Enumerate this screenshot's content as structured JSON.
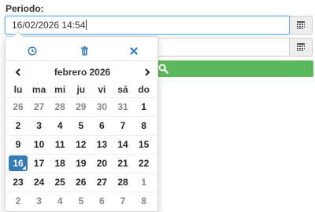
{
  "form": {
    "label": "Periodo:",
    "start_value": "16/02/2026 14:54",
    "end_value": ""
  },
  "colors": {
    "accent": "#337ab7",
    "search_button": "#5cb85c",
    "icon_blue": "#337ab7"
  },
  "icons": {
    "calendar_addon": "calendar-icon",
    "clock": "clock-icon",
    "trash": "trash-icon",
    "close": "close-icon",
    "prev": "chevron-left-icon",
    "next": "chevron-right-icon",
    "search": "search-icon"
  },
  "calendar": {
    "month_label": "febrero 2026",
    "weekdays": [
      "lu",
      "ma",
      "mi",
      "ju",
      "vi",
      "sá",
      "do"
    ],
    "weeks": [
      [
        "26",
        "27",
        "28",
        "29",
        "30",
        "31",
        "1"
      ],
      [
        "2",
        "3",
        "4",
        "5",
        "6",
        "7",
        "8"
      ],
      [
        "9",
        "10",
        "11",
        "12",
        "13",
        "14",
        "15"
      ],
      [
        "16",
        "17",
        "18",
        "19",
        "20",
        "21",
        "22"
      ],
      [
        "23",
        "24",
        "25",
        "26",
        "27",
        "28",
        "1"
      ],
      [
        "2",
        "3",
        "4",
        "5",
        "6",
        "7",
        "8"
      ]
    ],
    "other_month_flags": [
      [
        true,
        true,
        true,
        true,
        true,
        true,
        false
      ],
      [
        false,
        false,
        false,
        false,
        false,
        false,
        false
      ],
      [
        false,
        false,
        false,
        false,
        false,
        false,
        false
      ],
      [
        false,
        false,
        false,
        false,
        false,
        false,
        false
      ],
      [
        false,
        false,
        false,
        false,
        false,
        false,
        true
      ],
      [
        true,
        true,
        true,
        true,
        true,
        true,
        true
      ]
    ],
    "selected_day": "16"
  }
}
